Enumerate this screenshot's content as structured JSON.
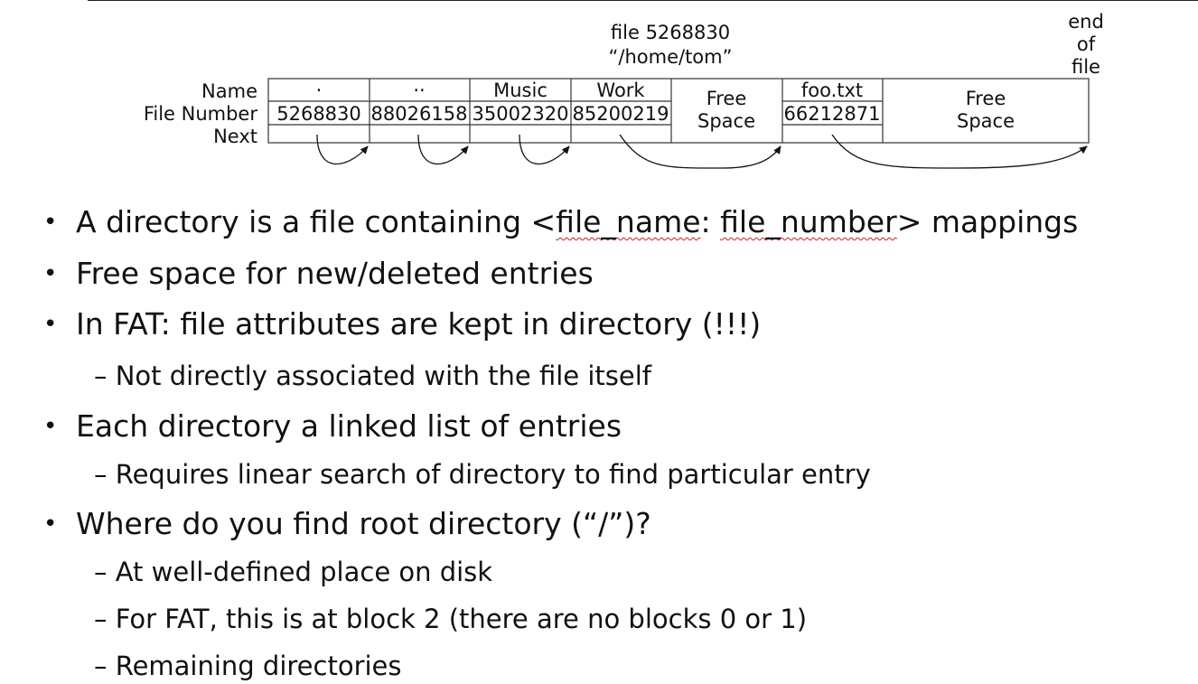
{
  "diagram": {
    "header_file_number": "file 5268830",
    "header_path": "“/home/tom”",
    "end_of_file": [
      "end",
      "of",
      "file"
    ],
    "row_labels": [
      "Name",
      "File Number",
      "Next"
    ],
    "entries": [
      {
        "name": "·",
        "number": "5268830"
      },
      {
        "name": "··",
        "number": "88026158"
      },
      {
        "name": "Music",
        "number": "35002320"
      },
      {
        "name": "Work",
        "number": "85200219"
      },
      {
        "free": [
          "Free",
          "Space"
        ]
      },
      {
        "name": "foo.txt",
        "number": "66212871"
      },
      {
        "free": [
          "Free",
          "Space"
        ]
      }
    ]
  },
  "bullets": [
    {
      "level": 1,
      "marker": "•",
      "parts": [
        {
          "text": "A directory is a file containing <"
        },
        {
          "text": "file_name",
          "squiggle": true
        },
        {
          "text": ": "
        },
        {
          "text": "file_number",
          "squiggle": true
        },
        {
          "text": "> mappings"
        }
      ]
    },
    {
      "level": 1,
      "marker": "•",
      "text": "Free space for new/deleted entries"
    },
    {
      "level": 1,
      "marker": "•",
      "text": "In FAT: file attributes are kept in directory (!!!)"
    },
    {
      "level": 2,
      "marker": "–",
      "text": "Not directly associated with the file itself"
    },
    {
      "level": 1,
      "marker": "•",
      "text": "Each directory a linked list of entries"
    },
    {
      "level": 2,
      "marker": "–",
      "text": "Requires linear search of directory to find particular entry"
    },
    {
      "level": 1,
      "marker": "•",
      "text": "Where do you find root directory (“/”)?"
    },
    {
      "level": 2,
      "marker": "–",
      "text": "At well-defined place on disk"
    },
    {
      "level": 2,
      "marker": "–",
      "text": "For FAT, this is at block 2 (there are no blocks 0 or 1)"
    },
    {
      "level": 2,
      "marker": "–",
      "text": "Remaining directories"
    }
  ]
}
